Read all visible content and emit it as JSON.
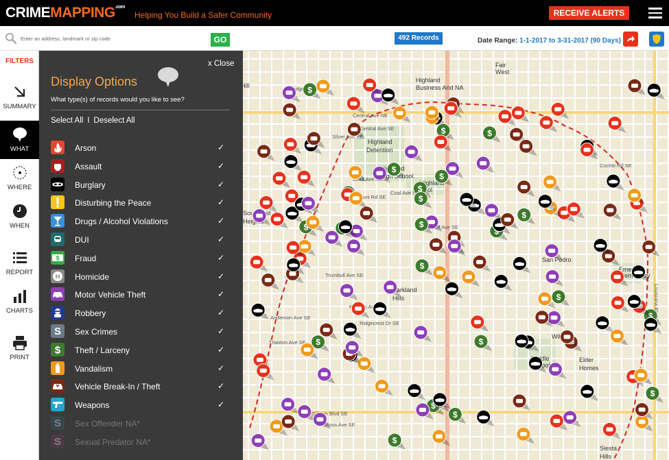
{
  "header": {
    "logo_crime": "CRIME",
    "logo_mapping": "MAPPING",
    "logo_suffix": ".com",
    "tagline": "Helping You Build a Safer Community",
    "alerts_button": "RECEIVE ALERTS"
  },
  "search": {
    "placeholder": "Enter an address, landmark or zip code",
    "go_label": "GO",
    "records_label": "492 Records",
    "date_range_label": "Date Range:",
    "date_range_value": "1-1-2017 to 3-31-2017 (90 Days)"
  },
  "rail": {
    "filters_label": "FILTERS",
    "items": [
      {
        "label": "SUMMARY"
      },
      {
        "label": "WHAT"
      },
      {
        "label": "WHERE"
      },
      {
        "label": "WHEN"
      },
      {
        "label": "REPORT"
      },
      {
        "label": "CHARTS"
      },
      {
        "label": "PRINT"
      }
    ]
  },
  "panel": {
    "close_label": "x Close",
    "title": "Display Options",
    "subtitle": "What type(s) of records would you like to see?",
    "select_all": "Select All",
    "separator": "I",
    "deselect_all": "Deselect All",
    "filters": [
      {
        "label": "Arson",
        "color": "#e8452c",
        "icon": "flame-icon",
        "checked": "✓"
      },
      {
        "label": "Assault",
        "color": "#b01c22",
        "icon": "fist-icon",
        "checked": "✓"
      },
      {
        "label": "Burglary",
        "color": "#000000",
        "icon": "mask-icon",
        "checked": "✓"
      },
      {
        "label": "Disturbing the Peace",
        "color": "#f5c518",
        "icon": "exclamation-icon",
        "checked": "✓"
      },
      {
        "label": "Drugs / Alcohol Violations",
        "color": "#3a8fd6",
        "icon": "cocktail-icon",
        "checked": "✓"
      },
      {
        "label": "DUI",
        "color": "#1f6b6b",
        "icon": "car-front-icon",
        "checked": "✓"
      },
      {
        "label": "Fraud",
        "color": "#2db04b",
        "icon": "money-card-icon",
        "checked": "✓"
      },
      {
        "label": "Homicide",
        "color": "#8a8a8a",
        "icon": "h-letter-icon",
        "checked": "✓"
      },
      {
        "label": "Motor Vehicle Theft",
        "color": "#8e3fb6",
        "icon": "car-icon",
        "checked": "✓"
      },
      {
        "label": "Robbery",
        "color": "#1f3a8f",
        "icon": "robber-icon",
        "checked": "✓"
      },
      {
        "label": "Sex Crimes",
        "color": "#6b7b88",
        "icon": "s-letter-icon",
        "checked": "✓"
      },
      {
        "label": "Theft / Larceny",
        "color": "#3e7a2e",
        "icon": "dollar-icon",
        "checked": "✓"
      },
      {
        "label": "Vandalism",
        "color": "#f29a1b",
        "icon": "spray-can-icon",
        "checked": "✓"
      },
      {
        "label": "Vehicle Break-In / Theft",
        "color": "#7a2a14",
        "icon": "car-break-icon",
        "checked": "✓"
      },
      {
        "label": "Weapons",
        "color": "#23a6c9",
        "icon": "gun-icon",
        "checked": "✓"
      },
      {
        "label": "Sex Offender NA*",
        "color": "#2f5f6f",
        "icon": "s-letter-icon",
        "checked": "",
        "disabled": true
      },
      {
        "label": "Sexual Predator NA*",
        "color": "#6b3b5b",
        "icon": "s-letter-icon",
        "checked": "",
        "disabled": true
      }
    ]
  },
  "map": {
    "place_labels": [
      "Highland",
      "Business And NA",
      "Fair",
      "West",
      "Highland",
      "Detention",
      "Highland",
      "High School",
      "Highland",
      "Pool",
      "Southeast",
      "Heights",
      "Parkland",
      "Hills",
      "San Pedro",
      "Elder",
      "Homes",
      "Siesta",
      "Hills",
      "Emerson",
      "Elementary",
      "Wilson",
      "Middle",
      "School",
      "Mb Hill"
    ],
    "street_labels": [
      "Ridgeley Ave NE",
      "Central Ave NE",
      "Central Ave SE",
      "Zuni Rd SE",
      "Bell Ave SE",
      "Anderson Ave SE",
      "Kathryn Ave SE",
      "Gibson Blvd SE",
      "Ross Ave SE",
      "Thaxton Ave SE",
      "Cochiti Rd SE",
      "Silver Ave SE",
      "Lead Ave SE",
      "Coal Ave SE",
      "Trumbull Ave SE",
      "Ridgecrest Dr SE",
      "Louisiana Blvd SE"
    ]
  }
}
